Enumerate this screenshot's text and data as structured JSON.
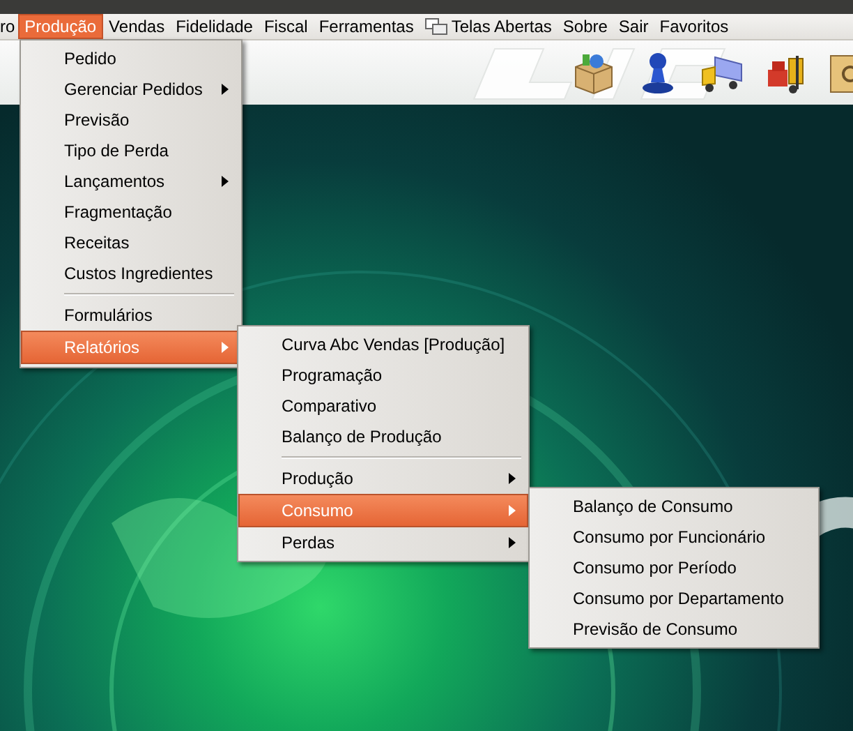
{
  "menubar": {
    "items": [
      {
        "label": "ro",
        "selected": false,
        "icon": false
      },
      {
        "label": "Produção",
        "selected": true,
        "icon": false
      },
      {
        "label": "Vendas",
        "selected": false,
        "icon": false
      },
      {
        "label": "Fidelidade",
        "selected": false,
        "icon": false
      },
      {
        "label": "Fiscal",
        "selected": false,
        "icon": false
      },
      {
        "label": "Ferramentas",
        "selected": false,
        "icon": false
      },
      {
        "label": "Telas Abertas",
        "selected": false,
        "icon": true
      },
      {
        "label": "Sobre",
        "selected": false,
        "icon": false
      },
      {
        "label": "Sair",
        "selected": false,
        "icon": false
      },
      {
        "label": "Favoritos",
        "selected": false,
        "icon": false
      }
    ]
  },
  "menus": [
    {
      "items": [
        {
          "kind": "item",
          "label": "Pedido",
          "submenu": false,
          "selected": false
        },
        {
          "kind": "item",
          "label": "Gerenciar Pedidos",
          "submenu": true,
          "selected": false
        },
        {
          "kind": "item",
          "label": "Previsão",
          "submenu": false,
          "selected": false
        },
        {
          "kind": "item",
          "label": "Tipo de Perda",
          "submenu": false,
          "selected": false
        },
        {
          "kind": "item",
          "label": "Lançamentos",
          "submenu": true,
          "selected": false
        },
        {
          "kind": "item",
          "label": "Fragmentação",
          "submenu": false,
          "selected": false
        },
        {
          "kind": "item",
          "label": "Receitas",
          "submenu": false,
          "selected": false
        },
        {
          "kind": "item",
          "label": "Custos Ingredientes",
          "submenu": false,
          "selected": false
        },
        {
          "kind": "separator"
        },
        {
          "kind": "item",
          "label": "Formulários",
          "submenu": false,
          "selected": false
        },
        {
          "kind": "item",
          "label": "Relatórios",
          "submenu": true,
          "selected": true
        }
      ]
    },
    {
      "items": [
        {
          "kind": "item",
          "label": "Curva Abc Vendas [Produção]",
          "submenu": false,
          "selected": false
        },
        {
          "kind": "item",
          "label": "Programação",
          "submenu": false,
          "selected": false
        },
        {
          "kind": "item",
          "label": "Comparativo",
          "submenu": false,
          "selected": false
        },
        {
          "kind": "item",
          "label": "Balanço de Produção",
          "submenu": false,
          "selected": false
        },
        {
          "kind": "separator"
        },
        {
          "kind": "item",
          "label": "Produção",
          "submenu": true,
          "selected": false
        },
        {
          "kind": "item",
          "label": "Consumo",
          "submenu": true,
          "selected": true
        },
        {
          "kind": "item",
          "label": "Perdas",
          "submenu": true,
          "selected": false
        }
      ]
    },
    {
      "items": [
        {
          "kind": "item",
          "label": "Balanço de Consumo",
          "submenu": false,
          "selected": false
        },
        {
          "kind": "item",
          "label": "Consumo por Funcionário",
          "submenu": false,
          "selected": false
        },
        {
          "kind": "item",
          "label": "Consumo por Período",
          "submenu": false,
          "selected": false
        },
        {
          "kind": "item",
          "label": "Consumo por Departamento",
          "submenu": false,
          "selected": false
        },
        {
          "kind": "item",
          "label": "Previsão de Consumo",
          "submenu": false,
          "selected": false
        }
      ]
    }
  ]
}
